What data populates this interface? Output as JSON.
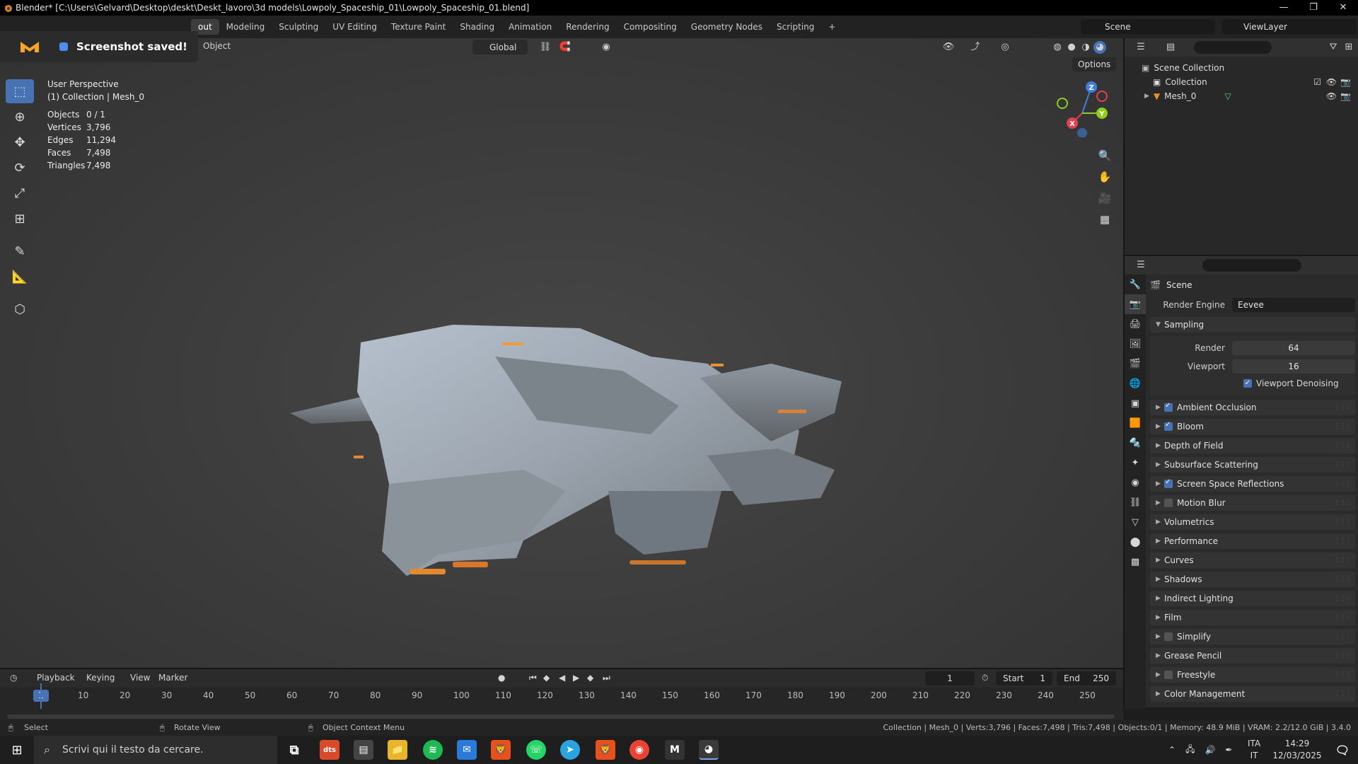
{
  "titlebar": {
    "title": "Blender* [C:\\Users\\Gelvard\\Desktop\\deskt\\Deskt_lavoro\\3d models\\Lowpoly_Spaceship_01\\Lowpoly_Spaceship_01.blend]",
    "minimize": "—",
    "restore": "❐",
    "close": "✕"
  },
  "workspaces": [
    {
      "label": "out",
      "active": true
    },
    {
      "label": "Modeling"
    },
    {
      "label": "Sculpting"
    },
    {
      "label": "UV Editing"
    },
    {
      "label": "Texture Paint"
    },
    {
      "label": "Shading"
    },
    {
      "label": "Animation"
    },
    {
      "label": "Rendering"
    },
    {
      "label": "Compositing"
    },
    {
      "label": "Geometry Nodes"
    },
    {
      "label": "Scripting"
    }
  ],
  "add_workspace": "+",
  "scene_name": "Scene",
  "view_layer": "ViewLayer",
  "notification": {
    "text": "Screenshot saved!"
  },
  "viewport": {
    "object_menu": "Object",
    "orientation": "Global",
    "options": "Options",
    "view_name": "User Perspective",
    "collection_info": "(1) Collection | Mesh_0",
    "stats": [
      {
        "label": "Objects",
        "value": "0 / 1"
      },
      {
        "label": "Vertices",
        "value": "3,796"
      },
      {
        "label": "Edges",
        "value": "11,294"
      },
      {
        "label": "Faces",
        "value": "7,498"
      },
      {
        "label": "Triangles",
        "value": "7,498"
      }
    ],
    "gizmo": {
      "x": "X",
      "y": "Y",
      "z": "Z"
    }
  },
  "outliner": {
    "scene_collection": "Scene Collection",
    "collection": "Collection",
    "mesh": "Mesh_0"
  },
  "properties": {
    "scene": "Scene",
    "render_engine_label": "Render Engine",
    "render_engine": "Eevee",
    "sampling": {
      "title": "Sampling",
      "render_label": "Render",
      "render": "64",
      "viewport_label": "Viewport",
      "viewport": "16",
      "denoising": "Viewport Denoising"
    },
    "panels": [
      {
        "label": "Ambient Occlusion",
        "checkbox": true,
        "checked": true
      },
      {
        "label": "Bloom",
        "checkbox": true,
        "checked": true
      },
      {
        "label": "Depth of Field"
      },
      {
        "label": "Subsurface Scattering"
      },
      {
        "label": "Screen Space Reflections",
        "checkbox": true,
        "checked": true
      },
      {
        "label": "Motion Blur",
        "checkbox": true,
        "checked": false
      },
      {
        "label": "Volumetrics"
      },
      {
        "label": "Performance"
      },
      {
        "label": "Curves"
      },
      {
        "label": "Shadows"
      },
      {
        "label": "Indirect Lighting"
      },
      {
        "label": "Film"
      },
      {
        "label": "Simplify",
        "checkbox": true,
        "checked": false
      },
      {
        "label": "Grease Pencil"
      },
      {
        "label": "Freestyle",
        "checkbox": true,
        "checked": false
      },
      {
        "label": "Color Management"
      }
    ]
  },
  "timeline": {
    "playback": "Playback",
    "keying": "Keying",
    "view": "View",
    "marker": "Marker",
    "current_frame": "1",
    "start_label": "Start",
    "start": "1",
    "end_label": "End",
    "end": "250",
    "ticks": [
      "10",
      "20",
      "30",
      "40",
      "50",
      "60",
      "70",
      "80",
      "90",
      "100",
      "110",
      "120",
      "130",
      "140",
      "150",
      "160",
      "170",
      "180",
      "190",
      "200",
      "210",
      "220",
      "230",
      "240",
      "250"
    ]
  },
  "statusbar": {
    "select": "Select",
    "rotate": "Rotate View",
    "context": "Object Context Menu",
    "info": "Collection | Mesh_0 | Verts:3,796 | Faces:7,498 | Tris:7,498 | Objects:0/1 | Memory: 48.9 MiB | VRAM: 2.2/12.0 GiB | 3.4.0"
  },
  "taskbar": {
    "search_placeholder": "Scrivi qui il testo da cercare.",
    "dts_label": "dts",
    "lang_top": "ITA",
    "lang_bottom": "IT",
    "time": "14:29",
    "date": "12/03/2025"
  },
  "colors": {
    "accent": "#4772b3",
    "axis_x": "#e2414f",
    "axis_y": "#8ccd1e",
    "axis_z": "#3f7ee0"
  }
}
